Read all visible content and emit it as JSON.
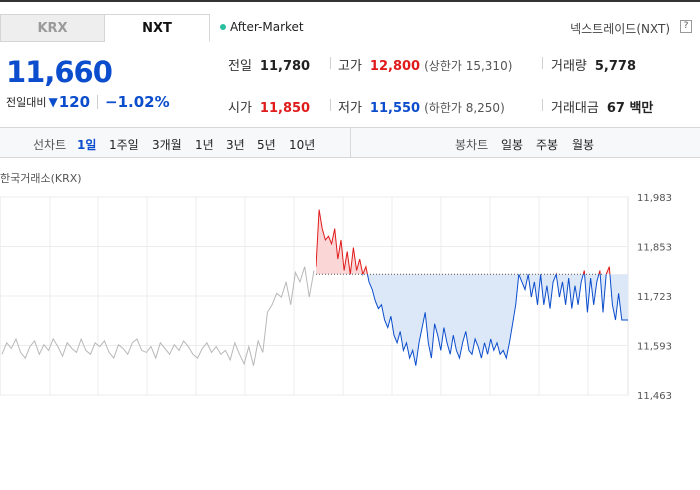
{
  "market_tabs": [
    {
      "label": "KRX",
      "active": false
    },
    {
      "label": "NXT",
      "active": true
    }
  ],
  "session_status": "After-Market",
  "data_source": "넥스트레이드(NXT)",
  "help_label": "?",
  "price": {
    "current": "11,660",
    "change_label": "전일대비",
    "change_arrow": "▼",
    "change_value": "120",
    "change_rate": "−1.02%"
  },
  "quote": {
    "prev_close": {
      "label": "전일",
      "value": "11,780"
    },
    "high": {
      "label": "고가",
      "value": "12,800",
      "note": "(상한가 15,310)"
    },
    "volume": {
      "label": "거래량",
      "value": "5,778"
    },
    "open": {
      "label": "시가",
      "value": "11,850"
    },
    "low": {
      "label": "저가",
      "value": "11,550",
      "note": "(하한가 8,250)"
    },
    "amount": {
      "label": "거래대금",
      "value": "67 백만"
    }
  },
  "line_chart_tabs": {
    "label": "선차트",
    "items": [
      "1일",
      "1주일",
      "3개월",
      "1년",
      "3년",
      "5년",
      "10년"
    ],
    "selected": "1일"
  },
  "candle_chart_tabs": {
    "label": "봉차트",
    "items": [
      "일봉",
      "주봉",
      "월봉"
    ]
  },
  "chart_source": "한국거래소(KRX)",
  "colors": {
    "up": "#e01b1b",
    "down": "#0b4dcc",
    "session_dot": "#2bbf9f",
    "up_fill": "#fbd6d6",
    "down_fill": "#dce8f8"
  },
  "chart_data": {
    "type": "line",
    "reference_price": 11780,
    "ylim": [
      11463,
      11983
    ],
    "y_ticks": [
      "11,983",
      "11,853",
      "11,723",
      "11,593",
      "11,463"
    ],
    "y_tick_values": [
      11983,
      11853,
      11723,
      11593,
      11463
    ],
    "grid": true,
    "series": [
      {
        "session": "pre-market",
        "values": [
          11570,
          11600,
          11585,
          11610,
          11575,
          11560,
          11590,
          11605,
          11570,
          11595,
          11580,
          11610,
          11590,
          11565,
          11600,
          11585,
          11575,
          11610,
          11580,
          11570,
          11600,
          11590,
          11605,
          11575,
          11560,
          11595,
          11585,
          11570,
          11600,
          11610,
          11580,
          11575,
          11590,
          11560,
          11600,
          11585,
          11570,
          11595,
          11580,
          11605,
          11590,
          11570,
          11560,
          11585,
          11600,
          11575,
          11590,
          11570,
          11580,
          11555,
          11600,
          11570,
          11545,
          11590,
          11540,
          11605,
          11575,
          11680,
          11700,
          11730,
          11720,
          11760,
          11700,
          11785,
          11760,
          11800,
          11720,
          11790
        ]
      },
      {
        "session": "after-market",
        "values": [
          11800,
          11950,
          11900,
          11870,
          11880,
          11860,
          11900,
          11820,
          11870,
          11790,
          11840,
          11780,
          11850,
          11790,
          11820,
          11780,
          11800,
          11760,
          11740,
          11710,
          11690,
          11700,
          11660,
          11640,
          11670,
          11620,
          11600,
          11630,
          11580,
          11600,
          11560,
          11580,
          11540,
          11600,
          11640,
          11680,
          11600,
          11560,
          11650,
          11620,
          11580,
          11640,
          11600,
          11570,
          11620,
          11580,
          11560,
          11600,
          11630,
          11580,
          11570,
          11610,
          11590,
          11560,
          11600,
          11570,
          11610,
          11580,
          11600,
          11570,
          11580,
          11560,
          11600,
          11650,
          11700,
          11780,
          11760,
          11740,
          11780,
          11720,
          11760,
          11700,
          11780,
          11700,
          11750,
          11690,
          11760,
          11780,
          11720,
          11760,
          11700,
          11770,
          11690,
          11750,
          11700,
          11760,
          11790,
          11680,
          11770,
          11700,
          11760,
          11790,
          11680,
          11780,
          11800,
          11700,
          11660,
          11730,
          11660,
          11660,
          11660
        ]
      }
    ]
  }
}
